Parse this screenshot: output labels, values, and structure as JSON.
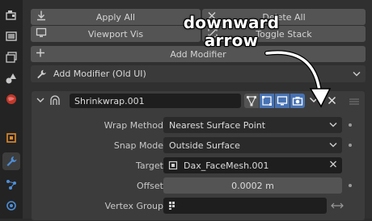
{
  "toolbar": {
    "apply_all": "Apply All",
    "delete_all": "Delete All",
    "viewport_vis": "Viewport Vis",
    "toggle_stack": "Toggle Stack",
    "add_modifier": "Add Modifier",
    "add_modifier_old": "Add Modifier (Old UI)"
  },
  "modifier": {
    "name": "Shrinkwrap.001",
    "props": [
      {
        "label": "Wrap Method",
        "value": "Nearest Surface Point"
      },
      {
        "label": "Snap Mode",
        "value": "Outside Surface"
      },
      {
        "label": "Target",
        "value": "Dax_FaceMesh.001"
      },
      {
        "label": "Offset",
        "value": "0.0002 m"
      },
      {
        "label": "Vertex Group",
        "value": ""
      }
    ]
  },
  "annotation": {
    "line1": "downward",
    "line2": "arrow"
  },
  "colors": {
    "panel_bg": "#303030",
    "button_bg": "#545454",
    "field_bg": "#1e1e1e",
    "active_toggle": "#4772b3",
    "annotation_text": "#ffffff"
  },
  "icons": [
    "render-icon",
    "output-icon",
    "view-layer-icon",
    "scene-icon",
    "world-icon",
    "object-icon",
    "modifier-wrench-icon",
    "particles-icon",
    "physics-icon",
    "constraints-icon"
  ]
}
